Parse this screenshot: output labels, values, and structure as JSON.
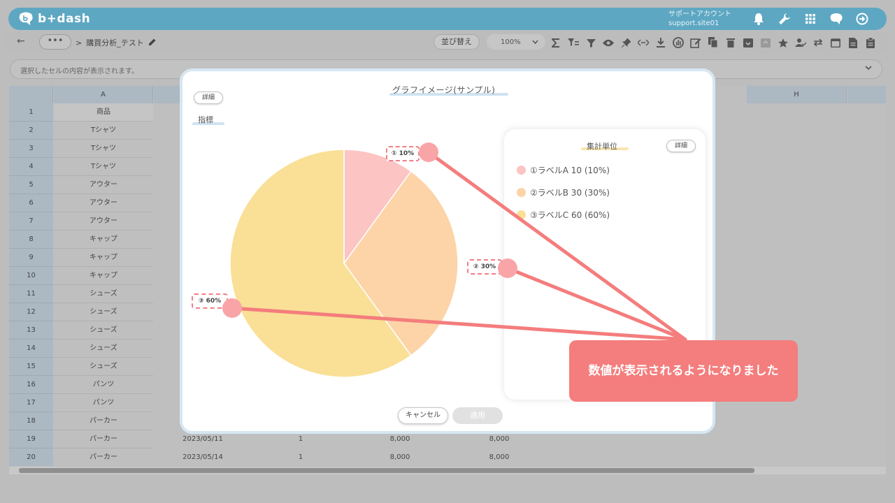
{
  "app": {
    "logo_text": "b+dash",
    "account_name": "サポートアカウント",
    "account_id": "support.site01"
  },
  "toolbar": {
    "back": "←",
    "more": "•••",
    "breadcrumb_sep": ">",
    "breadcrumb": "購買分析_テスト",
    "sort_label": "並び替え",
    "zoom": "100%"
  },
  "cellbar": {
    "placeholder": "選択したセルの内容が表示されます。"
  },
  "sheet": {
    "col_a": "A",
    "col_h": "H",
    "header_cell": "商品",
    "rows": [
      {
        "n": "1",
        "a": "商品"
      },
      {
        "n": "2",
        "a": "Tシャツ"
      },
      {
        "n": "3",
        "a": "Tシャツ"
      },
      {
        "n": "4",
        "a": "Tシャツ"
      },
      {
        "n": "5",
        "a": "アウター"
      },
      {
        "n": "6",
        "a": "アウター"
      },
      {
        "n": "7",
        "a": "アウター"
      },
      {
        "n": "8",
        "a": "キャップ"
      },
      {
        "n": "9",
        "a": "キャップ"
      },
      {
        "n": "10",
        "a": "キャップ"
      },
      {
        "n": "11",
        "a": "シューズ"
      },
      {
        "n": "12",
        "a": "シューズ"
      },
      {
        "n": "13",
        "a": "シューズ"
      },
      {
        "n": "14",
        "a": "シューズ"
      },
      {
        "n": "15",
        "a": "シューズ"
      },
      {
        "n": "16",
        "a": "パンツ"
      },
      {
        "n": "17",
        "a": "パンツ"
      },
      {
        "n": "18",
        "a": "パーカー"
      },
      {
        "n": "19",
        "a": "パーカー",
        "date": "2023/05/11",
        "qty": "1",
        "price": "8,000",
        "total": "8,000"
      },
      {
        "n": "20",
        "a": "パーカー",
        "date": "2023/05/14",
        "qty": "1",
        "price": "8,000",
        "total": "8,000"
      }
    ]
  },
  "modal": {
    "title": "グラフイメージ(サンプル)",
    "detail_button": "詳細",
    "metric_label": "指標",
    "legend_title": "集計単位",
    "legend_detail_button": "詳細",
    "cancel": "キャンセル",
    "apply": "適用"
  },
  "chart_data": {
    "type": "pie",
    "categories": [
      "ラベルA",
      "ラベルB",
      "ラベルC"
    ],
    "values": [
      10,
      30,
      60
    ],
    "percent_labels": [
      "① 10%",
      "② 30%",
      "③ 60%"
    ],
    "legend": [
      "①ラベルA 10 (10%)",
      "②ラベルB 30 (30%)",
      "③ラベルC 60 (60%)"
    ],
    "colors": [
      "#fcc4c3",
      "#fcd4a7",
      "#f9e096"
    ]
  },
  "annotation": {
    "callout": "数値が表示されるようになりました",
    "color": "#f47d7d"
  }
}
